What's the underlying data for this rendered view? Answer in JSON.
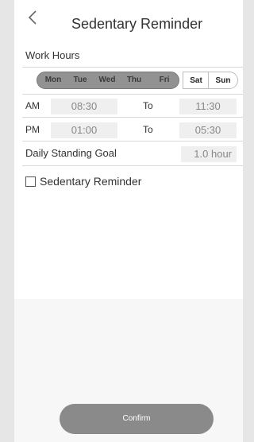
{
  "header": {
    "title": "Sedentary Reminder"
  },
  "work_hours": {
    "label": "Work Hours",
    "days": [
      {
        "label": "Mon",
        "selected": true
      },
      {
        "label": "Tue",
        "selected": true
      },
      {
        "label": "Wed",
        "selected": true
      },
      {
        "label": "Thu",
        "selected": true
      },
      {
        "label": "Fri",
        "selected": true
      },
      {
        "label": "Sat",
        "selected": false
      },
      {
        "label": "Sun",
        "selected": false
      }
    ],
    "am": {
      "label": "AM",
      "start": "08:30",
      "to": "To",
      "end": "11:30"
    },
    "pm": {
      "label": "PM",
      "start": "01:00",
      "to": "To",
      "end": "05:30"
    }
  },
  "goal": {
    "label": "Daily Standing Goal",
    "value": "1.0 hour"
  },
  "reminder": {
    "label": "Sedentary Reminder",
    "checked": false
  },
  "confirm_label": "Confirm",
  "colors": {
    "selected_days_bg": "#929292",
    "confirm_bg": "#8a8a8a",
    "page_bg": "#e6e6e6"
  }
}
